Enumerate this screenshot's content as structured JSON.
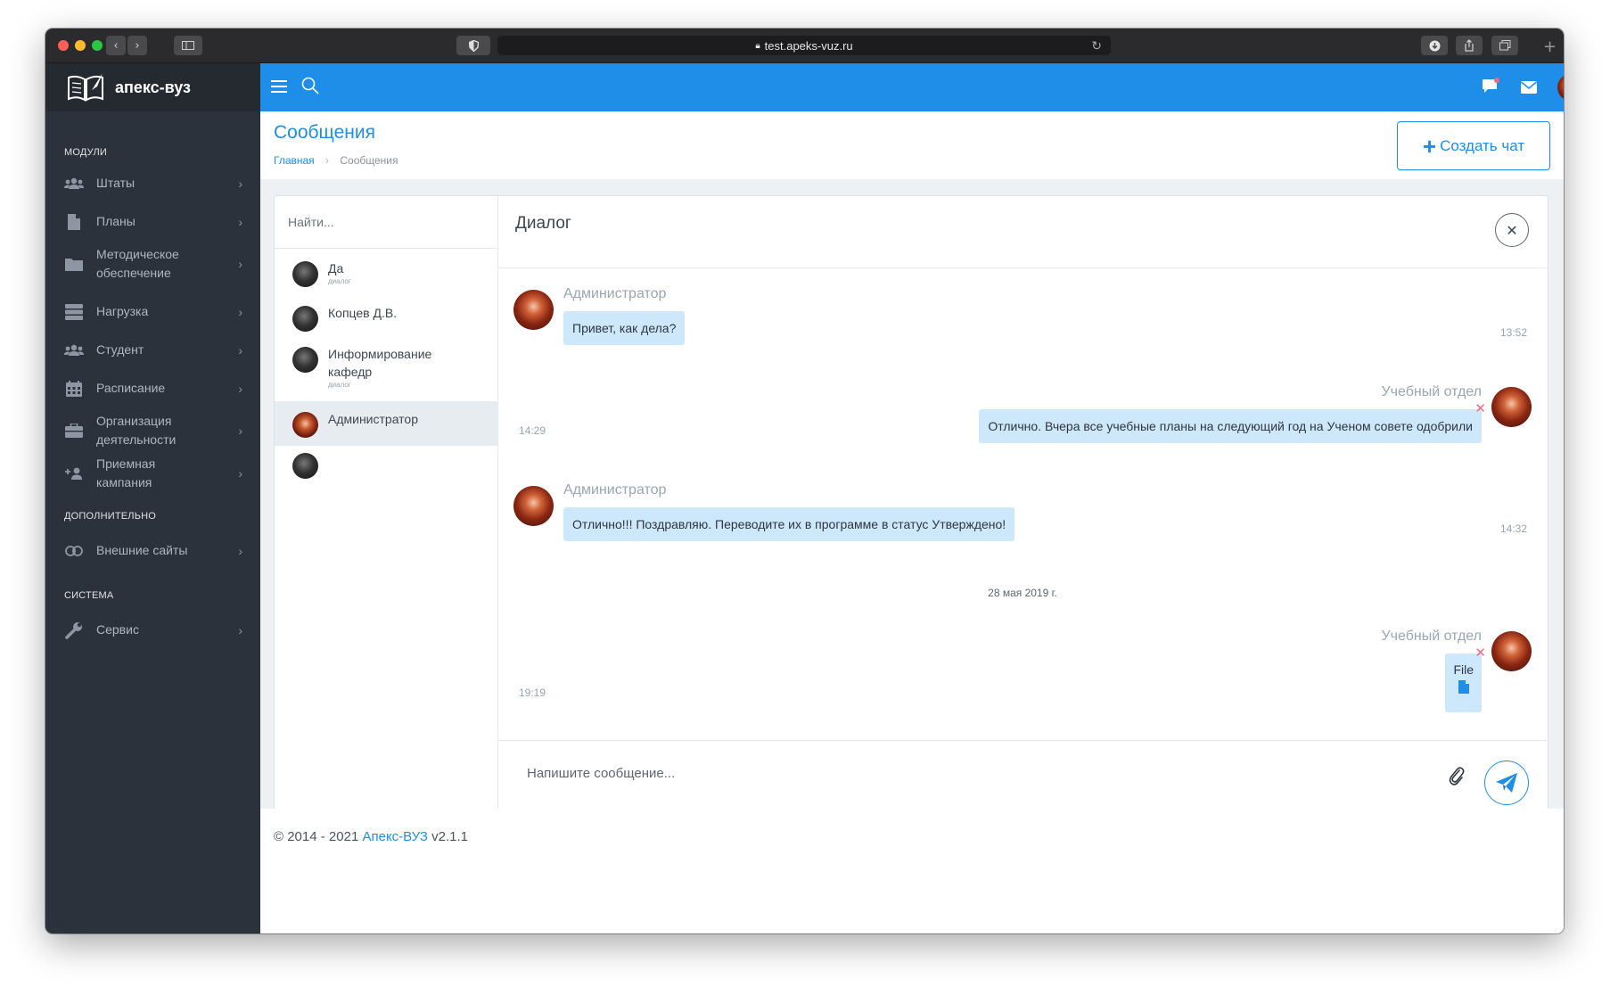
{
  "browser": {
    "url": "test.apeks-vuz.ru"
  },
  "app": {
    "logo_text": "апекс-вуз"
  },
  "sidebar": {
    "sections": [
      {
        "title": "модули"
      },
      {
        "title": "дополнительно"
      },
      {
        "title": "система"
      }
    ],
    "items": [
      {
        "label": "Штаты",
        "icon": "users-icon"
      },
      {
        "label": "Планы",
        "icon": "file-icon"
      },
      {
        "label": "Методическое обеспечение",
        "icon": "folder-icon"
      },
      {
        "label": "Нагрузка",
        "icon": "server-icon"
      },
      {
        "label": "Студент",
        "icon": "users-icon"
      },
      {
        "label": "Расписание",
        "icon": "calendar-icon"
      },
      {
        "label": "Организация деятельности",
        "icon": "briefcase-icon"
      },
      {
        "label": "Приемная кампания",
        "icon": "user-plus-icon"
      },
      {
        "label": "Внешние сайты",
        "icon": "link-icon"
      },
      {
        "label": "Сервис",
        "icon": "wrench-icon"
      }
    ]
  },
  "page": {
    "title": "Сообщения",
    "breadcrumb_home": "Главная",
    "breadcrumb_current": "Сообщения",
    "create_chat_label": "Создать чат"
  },
  "contacts": {
    "search_placeholder": "Найти...",
    "items": [
      {
        "name": "Да",
        "sub": "диалог"
      },
      {
        "name": "Копцев Д.В.",
        "sub": ""
      },
      {
        "name": "Информирование кафедр",
        "sub": "диалог"
      },
      {
        "name": "Администратор",
        "sub": ""
      },
      {
        "name": "",
        "sub": ""
      }
    ]
  },
  "dialog": {
    "title": "Диалог",
    "messages": [
      {
        "sender": "Администратор",
        "text": "Привет, как дела?",
        "time": "13:52"
      },
      {
        "sender": "Учебный отдел",
        "text": "Отлично. Вчера все учебные планы на следующий год на Ученом совете одобрили",
        "time": "14:29"
      },
      {
        "sender": "Администратор",
        "text": "Отлично!!! Поздравляю. Переводите их в программе в статус Утверждено!",
        "time": "14:32"
      },
      {
        "sender": "Учебный отдел",
        "text": "File",
        "time": "19:19"
      }
    ],
    "date_separator": "28 мая 2019 г.",
    "compose_placeholder": "Напишите сообщение..."
  },
  "footer": {
    "prefix": "© 2014 - 2021",
    "brand": "Апекс-ВУЗ",
    "version": "v2.1.1"
  },
  "colors": {
    "accent": "#1e8ee8",
    "sidebar_bg": "#2c323b",
    "bubble": "#cde8fb",
    "delete": "#f06a7f"
  }
}
